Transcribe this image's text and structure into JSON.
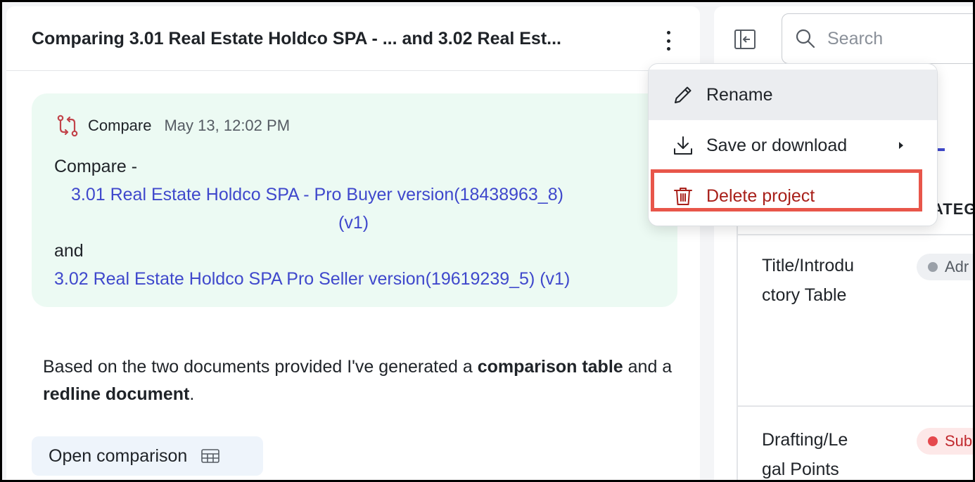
{
  "header": {
    "title": "Comparing 3.01 Real Estate Holdco SPA - ... and 3.02 Real Est..."
  },
  "compare_card": {
    "label": "Compare",
    "timestamp": "May 13, 12:02 PM",
    "intro": "Compare -",
    "doc1_line1": "3.01 Real Estate Holdco SPA - Pro Buyer version(18438963_8)",
    "doc1_line2": "(v1)",
    "conjunction": "and",
    "doc2": "3.02 Real Estate Holdco SPA Pro Seller version(19619239_5) (v1)"
  },
  "message": {
    "text_1": "Based on the two documents provided I've generated a ",
    "bold_1": "comparison table",
    "text_2": " and a ",
    "bold_2": "redline document",
    "text_3": "."
  },
  "open_button": {
    "label": "Open comparison"
  },
  "search": {
    "placeholder": "Search",
    "value": ""
  },
  "table": {
    "column_header_partial": "ATEGO",
    "rows": [
      {
        "label_line1": "Title/Introdu",
        "label_line2": "ctory Table",
        "status": "Adr"
      },
      {
        "label_line1": "Drafting/Le",
        "label_line2": "gal Points",
        "status": "Sub"
      }
    ]
  },
  "menu": {
    "items": [
      {
        "label": "Rename",
        "icon": "pencil-icon"
      },
      {
        "label": "Save or download",
        "icon": "download-icon",
        "has_submenu": true
      },
      {
        "label": "Delete project",
        "icon": "trash-icon"
      }
    ]
  },
  "colors": {
    "link": "#3f48cc",
    "card_bg": "#ecfaf3",
    "danger": "#a8201a",
    "highlight": "#e8564a"
  }
}
